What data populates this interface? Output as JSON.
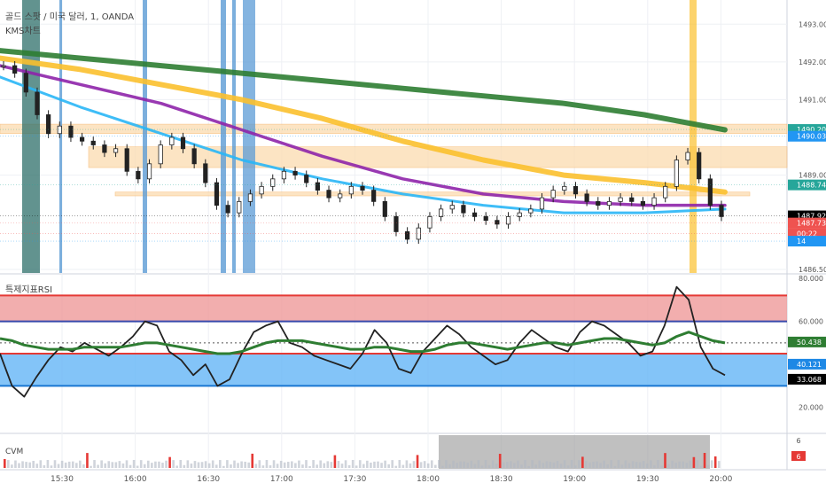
{
  "header": {
    "symbol_title": "골드 스팟 / 미국 달러, 1, OANDA",
    "indicator_title": "KMS차트"
  },
  "rsi_panel": {
    "title": "특제지표RSI"
  },
  "volume_panel": {
    "title": "CVM"
  },
  "chart_data": [
    {
      "type": "candlestick",
      "title": "골드 스팟 / 미국 달러, 1, OANDA",
      "y_ticks": [
        "1493.000",
        "1492.000",
        "1491.000",
        "1489.000",
        "1486.500"
      ],
      "ylim": [
        1486.5,
        1493.5
      ],
      "price_labels": [
        {
          "text": "1490.208",
          "value": 1490.21,
          "color": "#26a69a"
        },
        {
          "text": "1490.033",
          "value": 1490.03,
          "color": "#2196f3"
        },
        {
          "text": "1488.740",
          "value": 1488.74,
          "color": "#26a69a"
        },
        {
          "text": "1487.921",
          "value": 1487.92,
          "color": "#000000"
        },
        {
          "text": "1487.734",
          "value": 1487.73,
          "color": "#ef5350"
        },
        {
          "text": "00:22",
          "value": 1487.45,
          "color": "#ef5350"
        },
        {
          "text": "14",
          "value": 1487.25,
          "color": "#2196f3"
        }
      ],
      "x_ticks": [
        "15:30",
        "16:00",
        "16:30",
        "17:00",
        "17:30",
        "18:00",
        "18:30",
        "19:00",
        "19:30",
        "20:00"
      ],
      "zones": [
        {
          "from": 1490.35,
          "to": 1490.1
        },
        {
          "from": 1489.75,
          "to": 1489.2
        },
        {
          "from": 1488.55,
          "to": 1488.45
        }
      ],
      "close_series": [
        1491.9,
        1491.7,
        1491.2,
        1490.6,
        1490.1,
        1490.3,
        1490.0,
        1489.9,
        1489.8,
        1489.6,
        1489.7,
        1489.1,
        1488.9,
        1489.3,
        1489.8,
        1490.0,
        1489.7,
        1489.3,
        1488.8,
        1488.2,
        1488.0,
        1488.3,
        1488.5,
        1488.7,
        1488.9,
        1489.1,
        1489.0,
        1488.8,
        1488.6,
        1488.4,
        1488.5,
        1488.7,
        1488.6,
        1488.3,
        1487.9,
        1487.5,
        1487.3,
        1487.6,
        1487.9,
        1488.1,
        1488.2,
        1488.0,
        1487.9,
        1487.8,
        1487.7,
        1487.9,
        1488.0,
        1488.1,
        1488.4,
        1488.6,
        1488.7,
        1488.5,
        1488.3,
        1488.2,
        1488.3,
        1488.4,
        1488.3,
        1488.2,
        1488.4,
        1488.7,
        1489.4,
        1489.6,
        1488.9,
        1488.2,
        1487.9
      ],
      "series": [
        {
          "name": "",
          "color": "#2e7d32",
          "values": [
            1492.3,
            1492.1,
            1491.9,
            1491.7,
            1491.5,
            1491.3,
            1491.1,
            1490.9,
            1490.6,
            1490.2
          ]
        },
        {
          "name": "",
          "color": "#fbc02d",
          "values": [
            1492.1,
            1491.8,
            1491.4,
            1491.0,
            1490.5,
            1489.9,
            1489.4,
            1489.0,
            1488.8,
            1488.55
          ]
        },
        {
          "name": "",
          "color": "#8e24aa",
          "values": [
            1491.9,
            1491.4,
            1490.9,
            1490.2,
            1489.5,
            1488.9,
            1488.5,
            1488.3,
            1488.2,
            1488.2
          ]
        },
        {
          "name": "",
          "color": "#29b6f6",
          "values": [
            1491.6,
            1490.8,
            1490.1,
            1489.4,
            1488.9,
            1488.5,
            1488.2,
            1488.0,
            1488.0,
            1488.1
          ]
        }
      ]
    },
    {
      "type": "line",
      "title": "특제지표RSI",
      "y_ticks": [
        "80.000",
        "60.000",
        "20.000"
      ],
      "ylim": [
        10,
        80
      ],
      "levels": [
        {
          "value": 72,
          "color": "#e53935"
        },
        {
          "value": 60,
          "color": "#3949ab"
        },
        {
          "value": 50,
          "color": "#555555"
        },
        {
          "value": 45,
          "color": "#e53935"
        },
        {
          "value": 30,
          "color": "#1976d2"
        }
      ],
      "bands": [
        {
          "from": 72,
          "to": 60,
          "color": "#ef9a9a"
        },
        {
          "from": 45,
          "to": 30,
          "color": "#64b5f6"
        }
      ],
      "value_labels": [
        {
          "text": "50.438",
          "value": 50.4,
          "color": "#2e7d32"
        },
        {
          "text": "40.121",
          "value": 40.1,
          "color": "#1e88e5"
        },
        {
          "text": "33.068",
          "value": 33.1,
          "color": "#000000"
        }
      ],
      "series": [
        {
          "name": "",
          "color": "#222222",
          "values": [
            45,
            30,
            25,
            34,
            42,
            48,
            46,
            50,
            47,
            44,
            48,
            53,
            60,
            58,
            46,
            42,
            35,
            40,
            30,
            33,
            45,
            55,
            58,
            60,
            50,
            48,
            44,
            42,
            40,
            38,
            45,
            56,
            50,
            38,
            36,
            46,
            52,
            58,
            54,
            48,
            44,
            40,
            42,
            50,
            56,
            52,
            48,
            46,
            55,
            60,
            58,
            54,
            50,
            44,
            46,
            58,
            76,
            70,
            48,
            38,
            35
          ]
        },
        {
          "name": "",
          "color": "#2e7d32",
          "values": [
            52,
            51,
            49,
            48,
            47,
            47,
            47,
            48,
            48,
            48,
            48,
            49,
            50,
            50,
            49,
            48,
            47,
            46,
            45,
            45,
            46,
            48,
            50,
            51,
            51,
            51,
            50,
            49,
            48,
            47,
            47,
            48,
            48,
            47,
            46,
            46,
            47,
            49,
            50,
            50,
            49,
            48,
            47,
            48,
            49,
            50,
            50,
            49,
            50,
            51,
            52,
            52,
            51,
            50,
            49,
            50,
            53,
            55,
            53,
            51,
            50
          ]
        }
      ]
    },
    {
      "type": "bar",
      "title": "CVM",
      "value_labels": [
        {
          "text": "6",
          "color": "#888888"
        },
        {
          "text": "6",
          "color": "#e53935"
        }
      ]
    }
  ]
}
